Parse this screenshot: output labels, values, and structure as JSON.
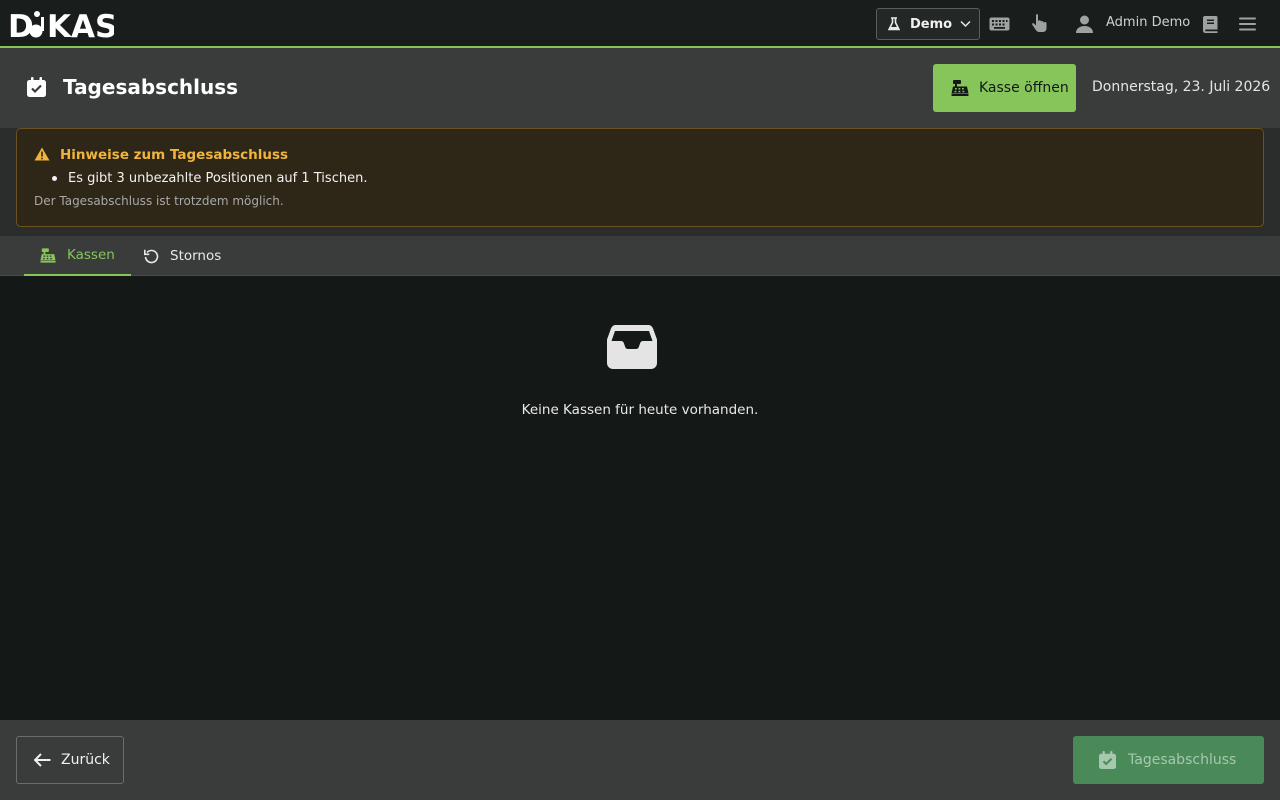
{
  "app": {
    "logo_text": "DIKAS",
    "environment_label": "Demo",
    "user_name": "Admin Demo"
  },
  "header": {
    "title": "Tagesabschluss",
    "open_register_label": "Kasse öffnen",
    "date": "Donnerstag, 23. Juli 2026"
  },
  "warning": {
    "title": "Hinweise zum Tagesabschluss",
    "items": [
      "Es gibt 3 unbezahlte Positionen auf 1 Tischen."
    ],
    "note": "Der Tagesabschluss ist trotzdem möglich."
  },
  "tabs": [
    {
      "label": "Kassen",
      "icon": "cash-register-icon",
      "active": true
    },
    {
      "label": "Stornos",
      "icon": "undo-icon",
      "active": false
    }
  ],
  "empty_state": {
    "icon": "inbox-icon",
    "text": "Keine Kassen für heute vorhanden."
  },
  "footer": {
    "back_label": "Zurück",
    "close_day_label": "Tagesabschluss"
  },
  "colors": {
    "accent": "#86c55a",
    "warning": "#f0b43c",
    "background": "#141816",
    "surface": "#3a3c3b",
    "disabled_primary": "#4a8a58"
  }
}
